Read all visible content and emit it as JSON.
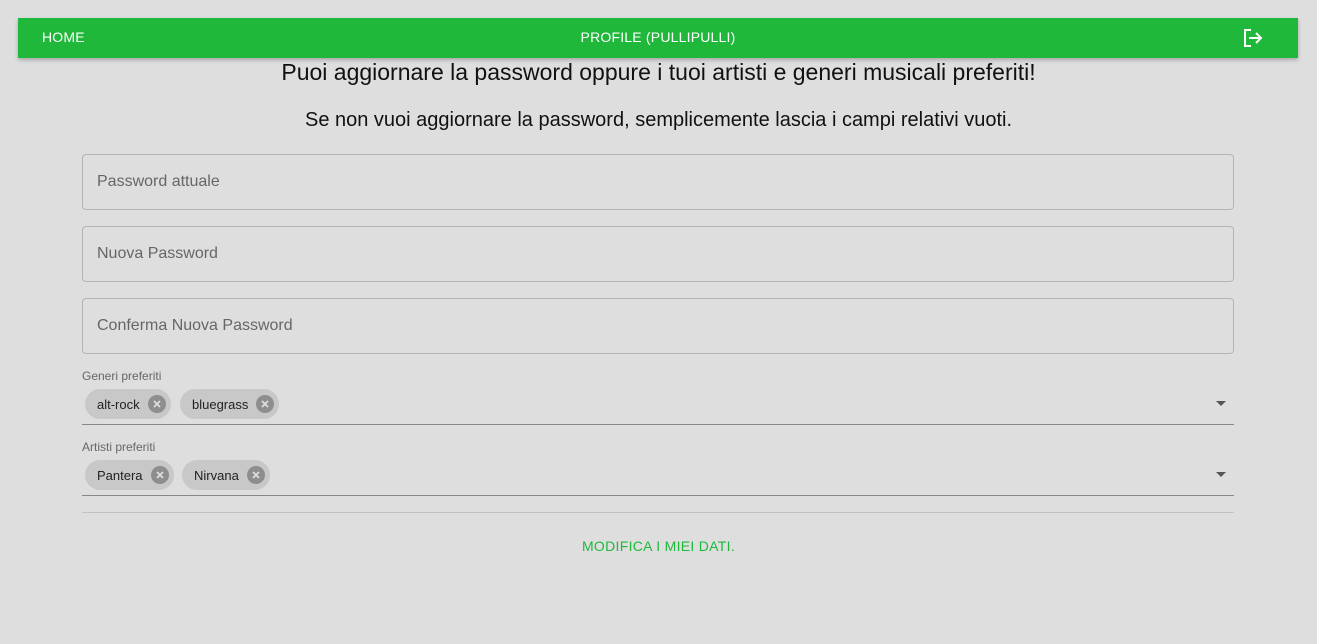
{
  "nav": {
    "home_label": "HOME",
    "profile_label": "PROFILE (PULLIPULLI)",
    "logout_icon": "logout-icon",
    "bar_color": "#1fb83a"
  },
  "main": {
    "heading": "Puoi aggiornare la password oppure i tuoi artisti e generi musicali preferiti!",
    "subheading": "Se non vuoi aggiornare la password, semplicemente lascia i campi relativi vuoti."
  },
  "form": {
    "current_password": {
      "placeholder": "Password attuale",
      "value": ""
    },
    "new_password": {
      "placeholder": "Nuova Password",
      "value": ""
    },
    "confirm_password": {
      "placeholder": "Conferma Nuova Password",
      "value": ""
    },
    "genres": {
      "label": "Generi preferiti",
      "chips": [
        "alt-rock",
        "bluegrass"
      ]
    },
    "artists": {
      "label": "Artisti preferiti",
      "chips": [
        "Pantera",
        "Nirvana"
      ]
    },
    "submit_label": "MODIFICA I MIEI DATI.",
    "accent_color": "#1fb83a"
  }
}
